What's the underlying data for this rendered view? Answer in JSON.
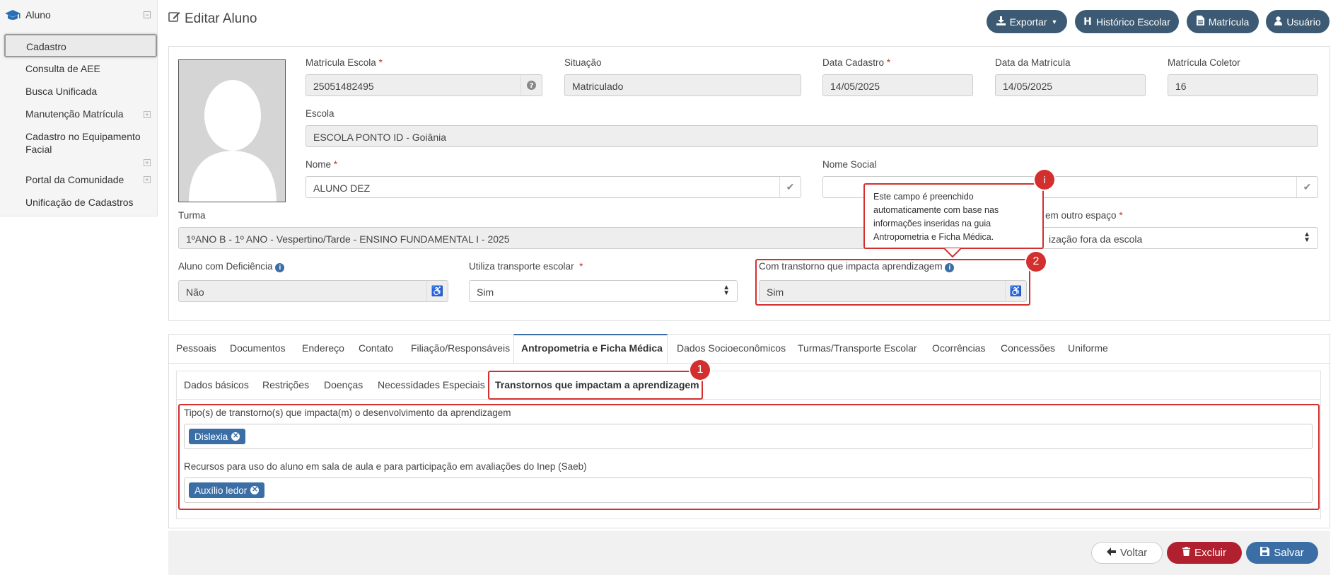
{
  "sidebar": {
    "section": "Aluno",
    "items": [
      {
        "label": "Cadastro"
      },
      {
        "label": "Consulta de AEE"
      },
      {
        "label": "Busca Unificada"
      },
      {
        "label": "Manutenção Matrícula"
      },
      {
        "label": "Cadastro no Equipamento"
      },
      {
        "label": "Facial"
      },
      {
        "label": "Portal da Comunidade"
      },
      {
        "label": "Unificação de Cadastros"
      }
    ]
  },
  "header": {
    "title": "Editar Aluno",
    "buttons": {
      "exportar": "Exportar",
      "historico": "Histórico Escolar",
      "matricula": "Matrícula",
      "usuario": "Usuário"
    }
  },
  "form": {
    "matricula_escola": {
      "label": "Matrícula Escola",
      "value": "25051482495"
    },
    "situacao": {
      "label": "Situação",
      "value": "Matriculado"
    },
    "data_cadastro": {
      "label": "Data Cadastro",
      "value": "14/05/2025"
    },
    "data_matricula": {
      "label": "Data da Matrícula",
      "value": "14/05/2025"
    },
    "matricula_coletor": {
      "label": "Matrícula Coletor",
      "value": "16"
    },
    "escola": {
      "label": "Escola",
      "value": "ESCOLA PONTO ID - Goiânia"
    },
    "nome": {
      "label": "Nome",
      "value": "ALUNO DEZ"
    },
    "nome_social": {
      "label": "Nome Social",
      "value": ""
    },
    "turma": {
      "label": "Turma",
      "value": "1ºANO B - 1º ANO - Vespertino/Tarde - ENSINO FUNDAMENTAL I - 2025"
    },
    "outro_espaco": {
      "label": "em outro espaço",
      "value": "ização fora da escola"
    },
    "deficiencia": {
      "label": "Aluno com Deficiência",
      "value": "Não"
    },
    "transporte": {
      "label": "Utiliza transporte escolar",
      "value": "Sim"
    },
    "transtorno": {
      "label": "Com transtorno que impacta aprendizagem",
      "value": "Sim"
    }
  },
  "tooltip": {
    "text_lines": [
      "Este campo é preenchido",
      "automaticamente com base nas",
      "informações inseridas na guia",
      "Antropometria e Ficha Médica."
    ],
    "badge": "i"
  },
  "tabs": [
    "Pessoais",
    "Documentos",
    "Endereço",
    "Contato",
    "Filiação/Responsáveis",
    "Antropometria e Ficha Médica",
    "Dados Socioeconômicos",
    "Turmas/Transporte Escolar",
    "Ocorrências",
    "Concessões",
    "Uniforme"
  ],
  "subtabs": [
    "Dados básicos",
    "Restrições",
    "Doenças",
    "Necessidades Especiais",
    "Transtornos que impactam a aprendizagem"
  ],
  "transtornos": {
    "tipos_label": "Tipo(s) de transtorno(s) que impacta(m) o desenvolvimento da aprendizagem",
    "tipos_tag": "Dislexia",
    "recursos_label": "Recursos para uso do aluno em sala de aula e para participação em avaliações do Inep (Saeb)",
    "recursos_tag": "Auxílio ledor"
  },
  "badges": {
    "one": "1",
    "two": "2"
  },
  "footer": {
    "voltar": "Voltar",
    "excluir": "Excluir",
    "salvar": "Salvar"
  },
  "colors": {
    "accent": "#3c5a73",
    "danger": "#b0202e",
    "primary": "#3b6ea5",
    "annotation": "#d32f2f"
  }
}
